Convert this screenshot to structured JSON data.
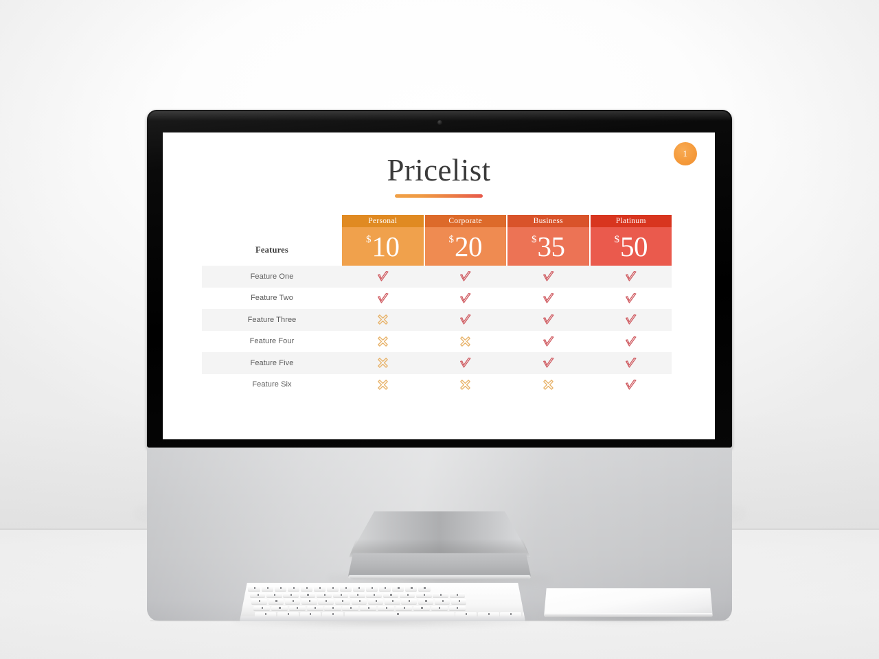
{
  "scene": {
    "device": "imac-desktop-monitor",
    "peripherals": [
      "keyboard",
      "trackpad"
    ]
  },
  "slide": {
    "page_badge": "1",
    "title": "Pricelist",
    "features_label": "Features",
    "colors": {
      "accent_start": "#f0a046",
      "accent_end": "#e7594a",
      "badge": "#f59b3c",
      "check": "#d05c62",
      "cross": "#e8b36a",
      "row_alt": "#f4f4f4",
      "title": "#3b3b3b"
    },
    "currency": "$",
    "plans": [
      {
        "name": "Personal",
        "price": "10",
        "head_color": "#e08a22",
        "body_color": "#f0a14c"
      },
      {
        "name": "Corporate",
        "price": "20",
        "head_color": "#dd6a2a",
        "body_color": "#ef8b51"
      },
      {
        "name": "Business",
        "price": "35",
        "head_color": "#d9532a",
        "body_color": "#ec7355"
      },
      {
        "name": "Platinum",
        "price": "50",
        "head_color": "#d8351f",
        "body_color": "#ea5a4d"
      }
    ],
    "features": [
      {
        "label": "Feature One",
        "values": [
          "check",
          "check",
          "check",
          "check"
        ]
      },
      {
        "label": "Feature Two",
        "values": [
          "check",
          "check",
          "check",
          "check"
        ]
      },
      {
        "label": "Feature Three",
        "values": [
          "cross",
          "check",
          "check",
          "check"
        ]
      },
      {
        "label": "Feature Four",
        "values": [
          "cross",
          "cross",
          "check",
          "check"
        ]
      },
      {
        "label": "Feature Five",
        "values": [
          "cross",
          "check",
          "check",
          "check"
        ]
      },
      {
        "label": "Feature Six",
        "values": [
          "cross",
          "cross",
          "cross",
          "check"
        ]
      }
    ]
  }
}
